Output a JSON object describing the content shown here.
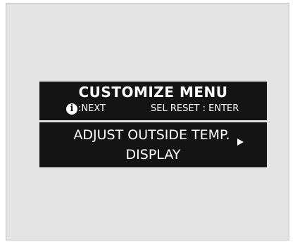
{
  "menu": {
    "title": "CUSTOMIZE MENU",
    "hint_info_glyph": "i",
    "hint_next": ":NEXT",
    "hint_sel_reset": "SEL RESET : ENTER"
  },
  "item": {
    "line1": "ADJUST OUTSIDE TEMP.",
    "line2": "DISPLAY"
  },
  "icons": {
    "info": "info-icon",
    "next_item": "right-arrow-icon"
  },
  "colors": {
    "screen_bg": "#141414",
    "screen_text": "#ffffff",
    "frame_bg": "#e3e3e3"
  }
}
